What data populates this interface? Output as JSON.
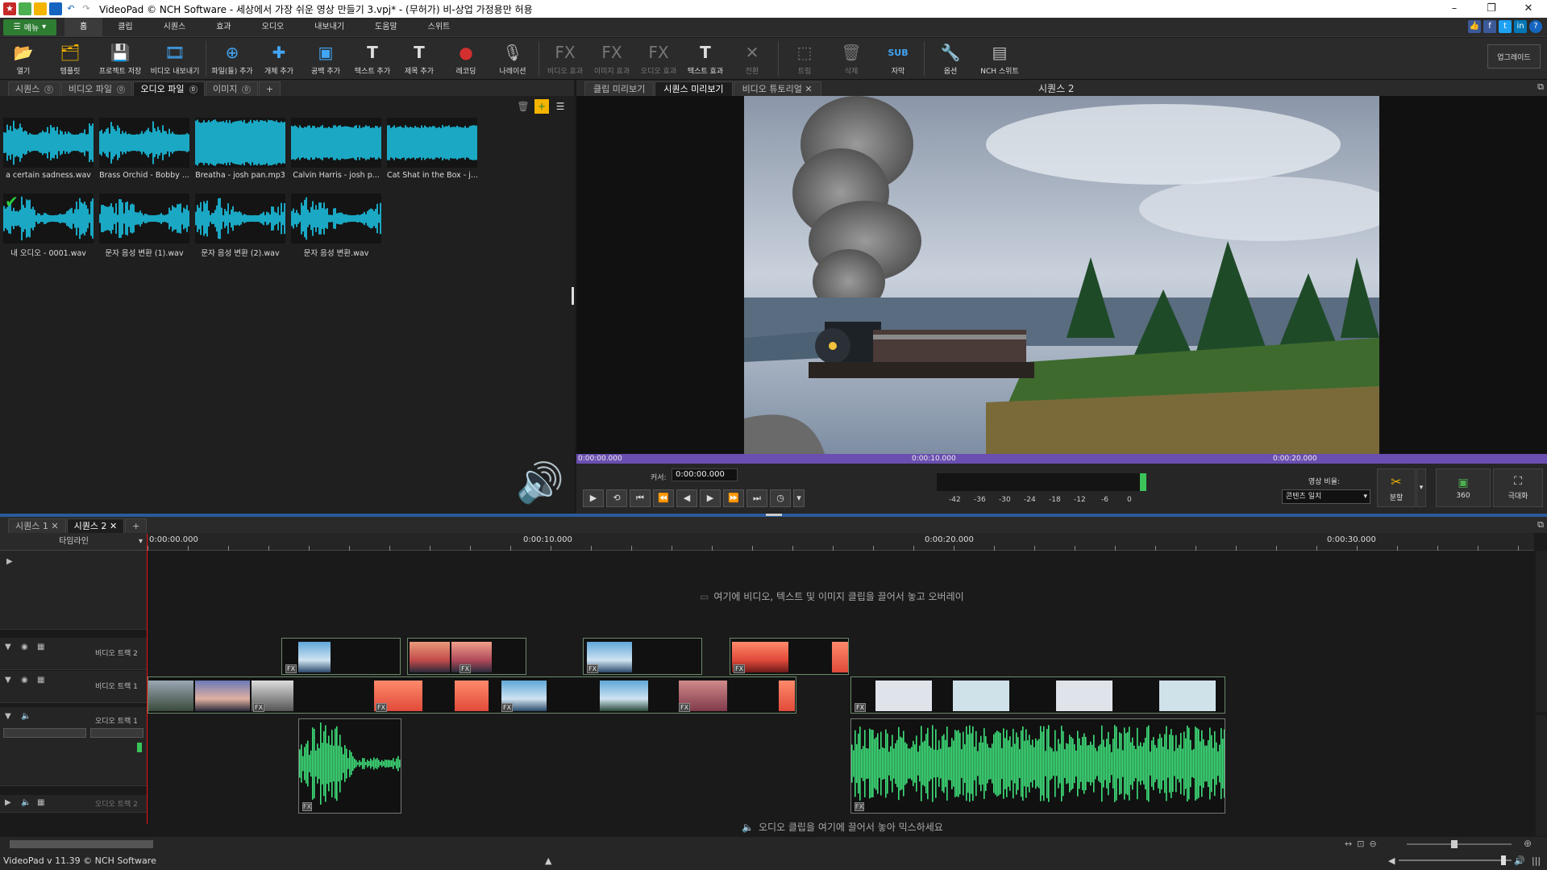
{
  "window": {
    "title": "VideoPad © NCH Software - 세상에서 가장 쉬운 영상 만들기 3.vpj* - (무허가) 비-상업 가정용만 허용"
  },
  "menu": {
    "menu_button": "메뉴",
    "tabs": [
      "홈",
      "클립",
      "시퀀스",
      "효과",
      "오디오",
      "내보내기",
      "도움말",
      "스위트"
    ],
    "active_tab": "홈"
  },
  "toolbar": {
    "buttons": [
      {
        "label": "열기",
        "icon": "folder-open-icon"
      },
      {
        "label": "템플릿",
        "icon": "template-icon"
      },
      {
        "label": "프로젝트 저장",
        "icon": "save-icon"
      },
      {
        "label": "비디오 내보내기",
        "icon": "export-video-icon"
      },
      {
        "label": "파일(들) 추가",
        "icon": "add-files-icon"
      },
      {
        "label": "개체 추가",
        "icon": "add-object-icon"
      },
      {
        "label": "공백 추가",
        "icon": "add-blank-icon"
      },
      {
        "label": "텍스트 추가",
        "icon": "add-text-icon"
      },
      {
        "label": "제목 추가",
        "icon": "add-title-icon"
      },
      {
        "label": "레코딩",
        "icon": "record-icon"
      },
      {
        "label": "나레이션",
        "icon": "microphone-icon"
      },
      {
        "label": "비디오 효과",
        "icon": "video-fx-icon"
      },
      {
        "label": "이미지 효과",
        "icon": "image-fx-icon"
      },
      {
        "label": "오디오 효과",
        "icon": "audio-fx-icon"
      },
      {
        "label": "텍스트 효과",
        "icon": "text-fx-icon"
      },
      {
        "label": "전환",
        "icon": "transition-icon"
      },
      {
        "label": "트림",
        "icon": "trim-icon"
      },
      {
        "label": "삭제",
        "icon": "trash-icon"
      },
      {
        "label": "자막",
        "icon": "subtitle-icon"
      },
      {
        "label": "옵션",
        "icon": "options-icon"
      },
      {
        "label": "NCH 스위트",
        "icon": "nch-suite-icon"
      }
    ],
    "upgrade_label": "업그레이드"
  },
  "bin": {
    "tabs": [
      {
        "label": "시퀀스",
        "count": "0"
      },
      {
        "label": "비디오 파일",
        "count": "0"
      },
      {
        "label": "오디오 파일",
        "count": "0"
      },
      {
        "label": "이미지",
        "count": "0"
      }
    ],
    "active_tab": "오디오 파일",
    "add_tab": "+",
    "clips": [
      {
        "name": "a certain sadness.wav"
      },
      {
        "name": "Brass Orchid - Bobby ..."
      },
      {
        "name": "Breatha - josh pan.mp3"
      },
      {
        "name": "Calvin Harris - josh p..."
      },
      {
        "name": "Cat Shat in the Box - j..."
      },
      {
        "name": "내 오디오 - 0001.wav"
      },
      {
        "name": "문자 음성 변환 (1).wav"
      },
      {
        "name": "문자 음성 변환 (2).wav"
      },
      {
        "name": "문자 음성 변환.wav"
      }
    ]
  },
  "preview": {
    "tabs": [
      "클립 미리보기",
      "시퀀스 미리보기",
      "비디오 튜토리얼"
    ],
    "active_tab": "시퀀스 미리보기",
    "sequence_title": "시퀀스 2",
    "time_marks": [
      "0:00:00.000",
      "0:00:10.000",
      "0:00:20.000"
    ],
    "cursor_label": "커서:",
    "cursor_value": "0:00:00.000",
    "meter_labels": [
      "-42",
      "-36",
      "-30",
      "-24",
      "-18",
      "-12",
      "-6",
      "0"
    ],
    "ratio_label": "영상 비율:",
    "ratio_value": "콘텐츠 일치",
    "split_label": "분할",
    "vr_label": "360",
    "fullscreen_label": "극대화"
  },
  "timeline": {
    "sequence_tabs": [
      "시퀀스 1",
      "시퀀스 2"
    ],
    "active_sequence": "시퀀스 2",
    "add_tab": "+",
    "header_label": "타임라인",
    "ruler_marks": [
      "0:00:00.000",
      "0:00:10.000",
      "0:00:20.000",
      "0:00:30.000"
    ],
    "overlay_hint": "여기에 비디오, 텍스트 및 이미지 클립을 끌어서 놓고 오버레이",
    "tracks": {
      "video2": "비디오 트랙 2",
      "video1": "비디오 트랙 1",
      "audio1": "오디오 트랙 1",
      "audio2": "오디오 트랙 2"
    },
    "audio_hint": "오디오 클립을 여기에 끌어서 놓아 믹스하세요"
  },
  "status": {
    "version": "VideoPad v 11.39 © NCH Software"
  },
  "colors": {
    "menu_green": "#2e7d32",
    "waveform_cyan": "#1aa8c4",
    "waveform_green": "#3ee07a",
    "scrub_purple": "#6a4fb0",
    "playhead_red": "#ee1111"
  }
}
